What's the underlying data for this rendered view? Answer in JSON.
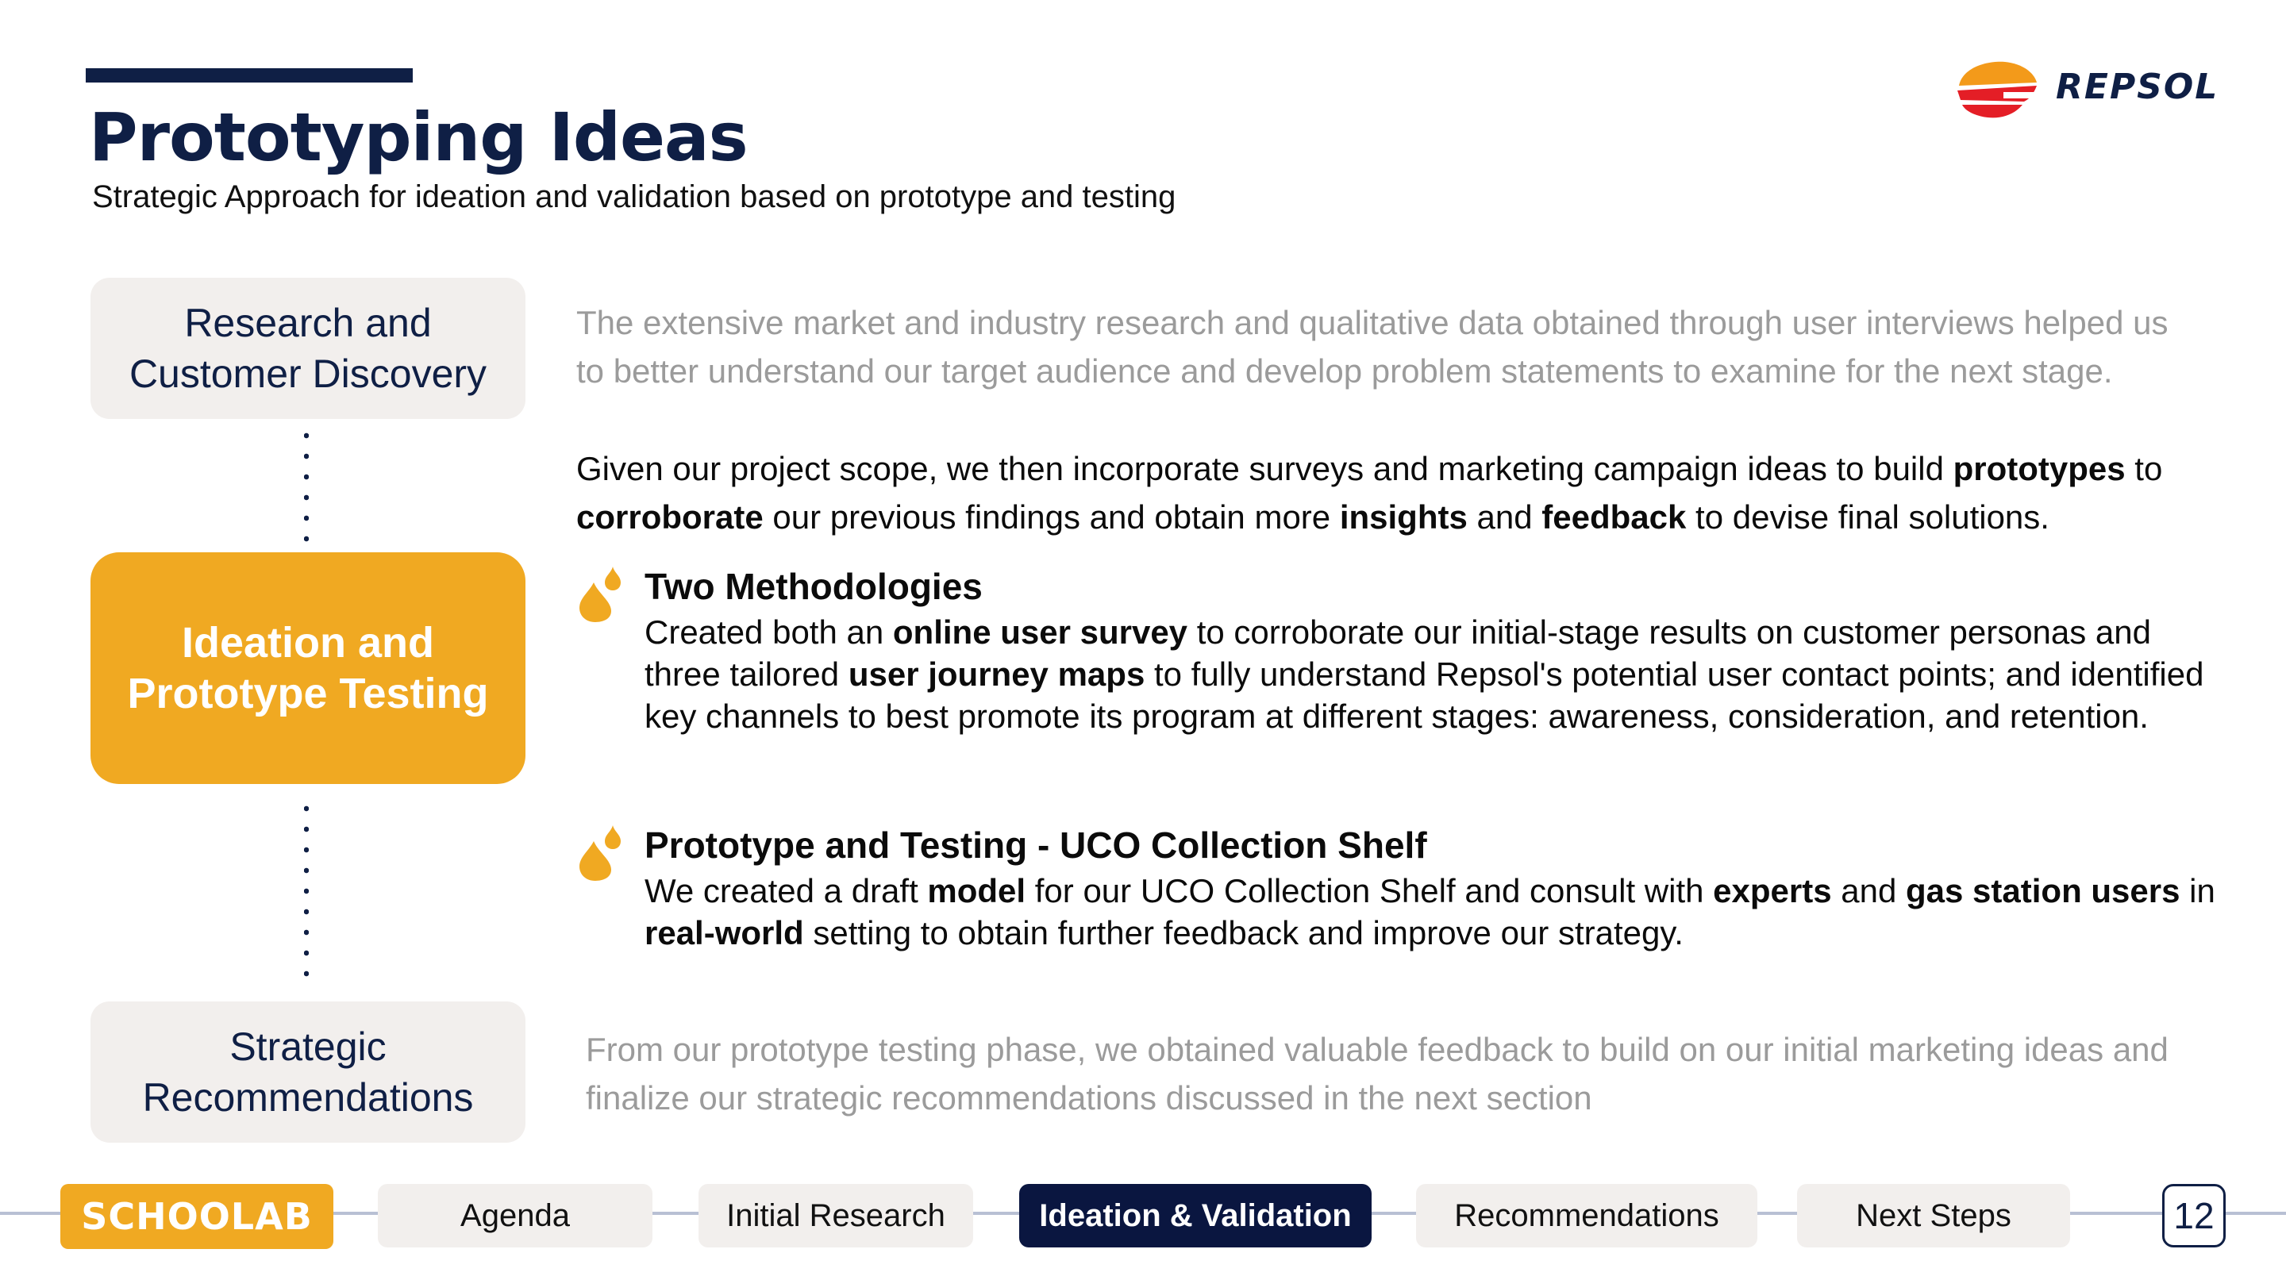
{
  "slide": {
    "title": "Prototyping Ideas",
    "subtitle": "Strategic Approach for ideation and validation based on prototype and testing",
    "logo_text": "REPSOL"
  },
  "stages": [
    {
      "label": "Research and\nCustomer Discovery",
      "active": false
    },
    {
      "label": "Ideation and\nPrototype Testing",
      "active": true
    },
    {
      "label": "Strategic\nRecommendations",
      "active": false
    }
  ],
  "intro": {
    "research_text": "The extensive market and industry research and qualitative data obtained through user interviews helped us to better understand our target audience and develop problem statements to examine for the next stage.",
    "scope_1": "Given our project scope, we then incorporate surveys and marketing campaign ideas to build ",
    "scope_b1": "prototypes",
    "scope_2": " to ",
    "scope_b2": "corroborate",
    "scope_3": " our previous findings and obtain more ",
    "scope_b3": "insights",
    "scope_4": " and ",
    "scope_b4": "feedback",
    "scope_5": " to devise final solutions."
  },
  "methodologies": [
    {
      "title": "Two Methodologies",
      "t1": "Created both an ",
      "b1": "online user survey",
      "t2": " to corroborate our initial-stage results on customer personas and three tailored ",
      "b2": "user journey maps",
      "t3": " to fully understand Repsol's potential user contact points; and identified key channels to best promote its program at different stages: awareness, consideration, and retention."
    },
    {
      "title": "Prototype and Testing - UCO Collection Shelf",
      "t1": "We created a draft ",
      "b1": "model",
      "t2": " for our UCO Collection Shelf and consult with ",
      "b2": "experts",
      "t3": " and ",
      "b3": "gas station users",
      "t4": " in ",
      "b4": "real-world",
      "t5": " setting to obtain further feedback and improve our strategy."
    }
  ],
  "conclusion": "From our prototype testing phase, we obtained valuable feedback to build on our initial marketing ideas and finalize our strategic recommendations discussed in the next section",
  "nav": {
    "brand": "SCHOOLAB",
    "items": [
      "Agenda",
      "Initial Research",
      "Ideation & Validation",
      "Recommendations",
      "Next Steps"
    ],
    "active": "Ideation & Validation",
    "page": "12"
  },
  "colors": {
    "navy": "#0f1f45",
    "accent": "#f0a922",
    "muted_box": "#f2efed",
    "gray_text": "#9b9b9b"
  }
}
